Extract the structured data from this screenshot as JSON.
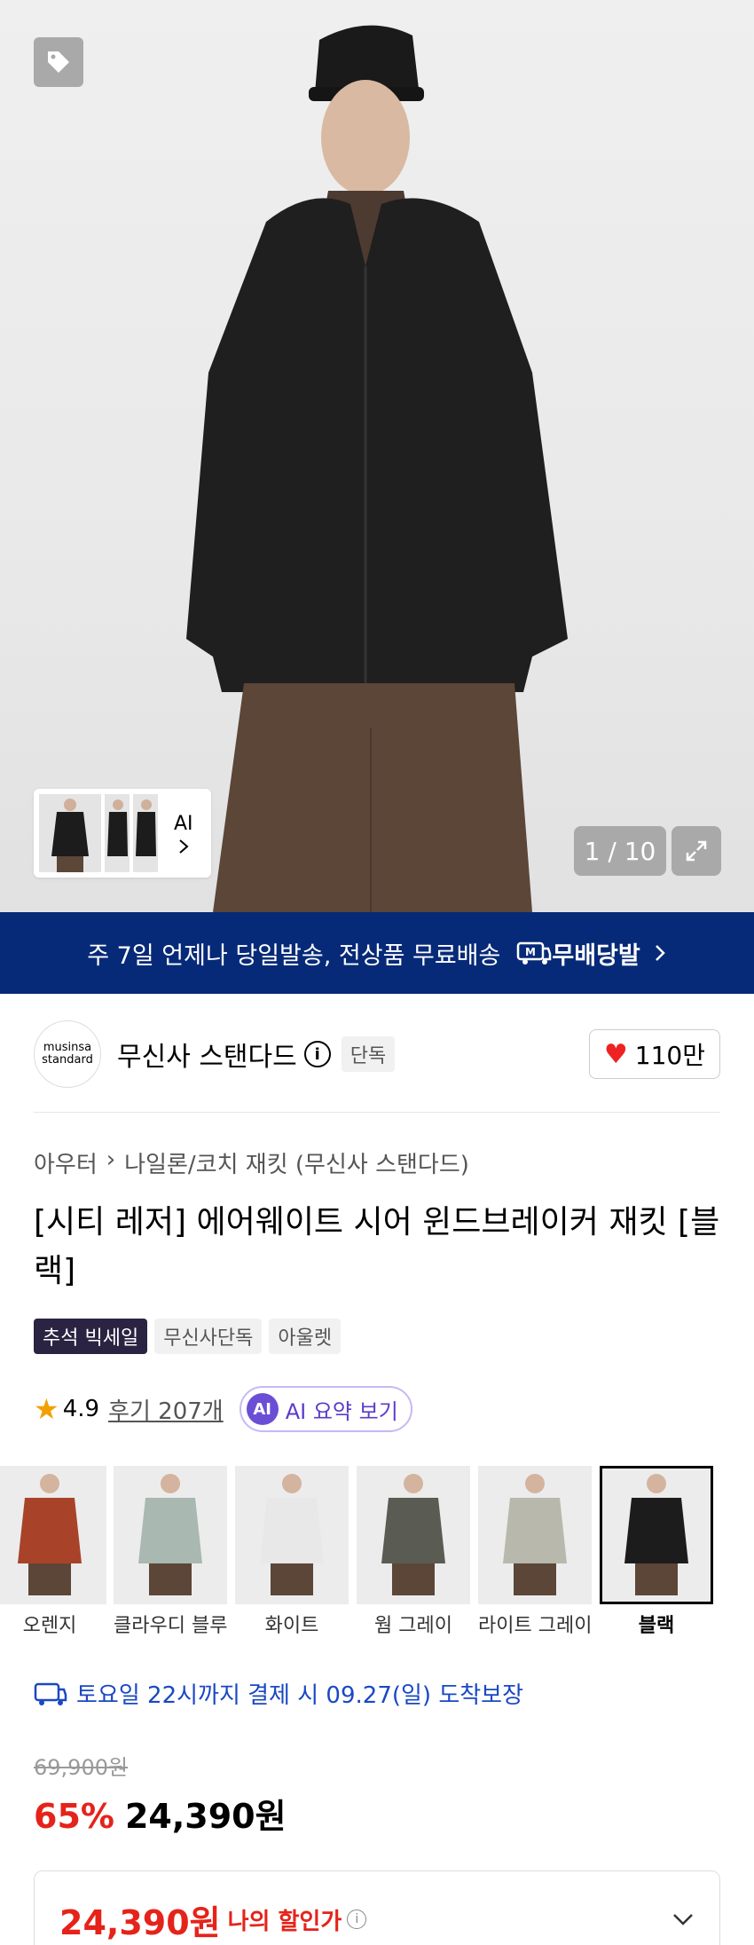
{
  "hero": {
    "counter": "1 / 10",
    "ai_label": "AI",
    "tag_icon": "tag-icon",
    "expand_icon": "expand-icon"
  },
  "banner": {
    "text": "주 7일 언제나 당일발송, 전상품 무료배송",
    "logo_text": "무배당발",
    "logo_mark": "M"
  },
  "brand": {
    "logo_line1": "musinsa",
    "logo_line2": "standard",
    "name": "무신사 스탠다드",
    "badge": "단독",
    "likes": "110만"
  },
  "breadcrumb": [
    "아우터",
    "나일론/코치 재킷 (무신사 스탠다드)"
  ],
  "product": {
    "title": "[시티 레저] 에어웨이트 시어 윈드브레이커 재킷 [블랙]",
    "badges": [
      "추석 빅세일",
      "무신사단독",
      "아울렛"
    ]
  },
  "rating": {
    "score": "4.9",
    "reviews": "후기 207개",
    "ai_summary": "AI 요약 보기",
    "ai_mark": "AI"
  },
  "colors": [
    {
      "label": "오렌지",
      "color": "#a8432a"
    },
    {
      "label": "클라우디 블루",
      "color": "#a9b8b0"
    },
    {
      "label": "화이트",
      "color": "#e8e8e8"
    },
    {
      "label": "웜 그레이",
      "color": "#5a5c54"
    },
    {
      "label": "라이트 그레이",
      "color": "#b8b8ac"
    },
    {
      "label": "블랙",
      "color": "#1c1c1c"
    }
  ],
  "delivery": {
    "text": "토요일 22시까지 결제 시 09.27(일) 도착보장"
  },
  "price": {
    "original": "69,900원",
    "discount": "65%",
    "sale": "24,390원",
    "my_price": "24,390원",
    "my_price_label": "나의 할인가"
  }
}
